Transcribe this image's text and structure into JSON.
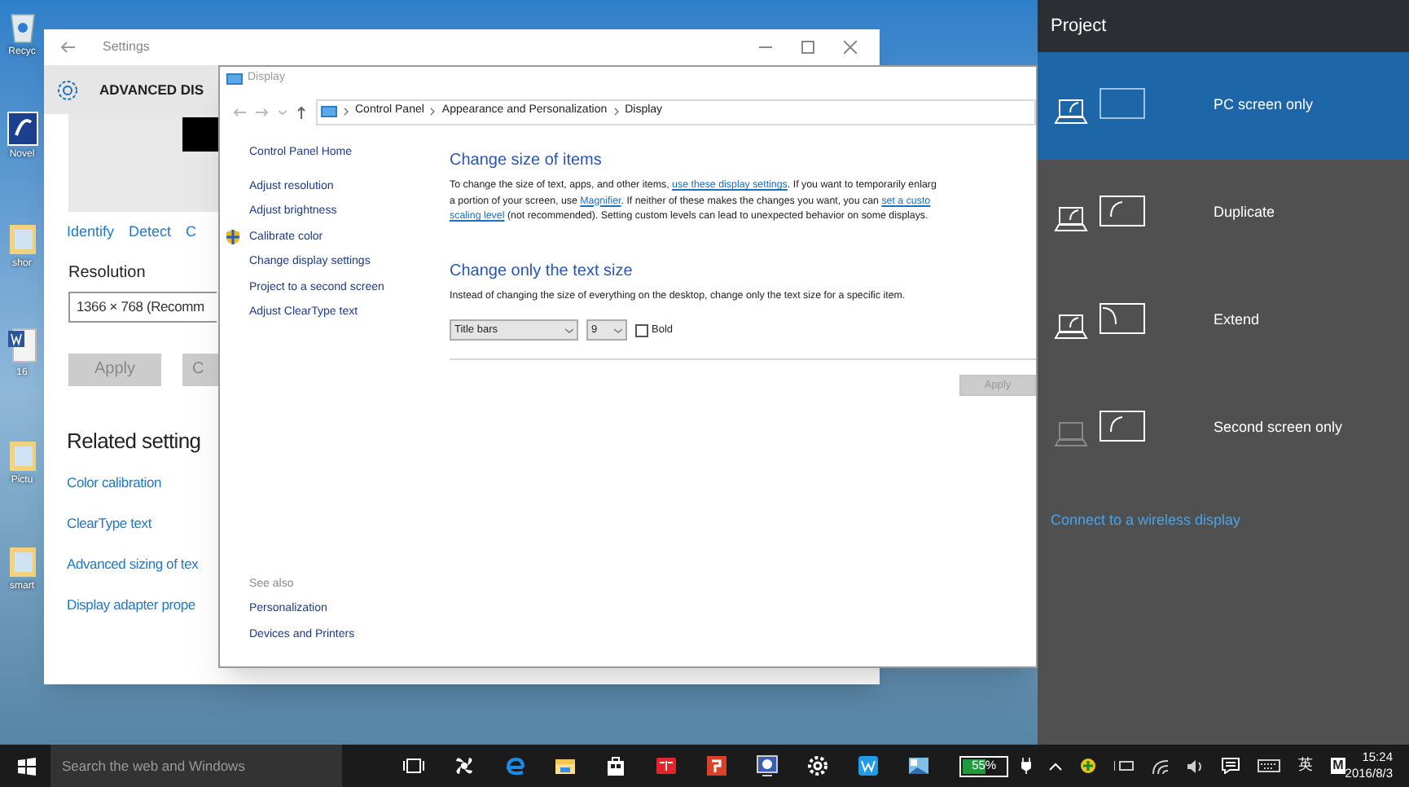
{
  "desktop_icons": [
    {
      "label": "Recyc",
      "kind": "bin"
    },
    {
      "label": "Novel",
      "kind": "app"
    },
    {
      "label": "shor",
      "kind": "folder"
    },
    {
      "label": "16",
      "kind": "doc"
    },
    {
      "label": "Pictu",
      "kind": "folder"
    },
    {
      "label": "smart",
      "kind": "folder"
    }
  ],
  "settings_window": {
    "title": "Settings",
    "header": "ADVANCED DIS",
    "links": [
      "Identify",
      "Detect",
      "C"
    ],
    "resolution_label": "Resolution",
    "resolution_value": "1366 × 768 (Recomm",
    "buttons": [
      "Apply",
      "C"
    ],
    "related_heading": "Related setting",
    "related_links": [
      "Color calibration",
      "ClearType text",
      "Advanced sizing of tex",
      "Display adapter prope"
    ]
  },
  "display_window": {
    "title": "Display",
    "breadcrumb": [
      "Control Panel",
      "Appearance and Personalization",
      "Display"
    ],
    "nav_home": "Control Panel Home",
    "nav_items": [
      {
        "label": "Adjust resolution",
        "kind": "link"
      },
      {
        "label": "Adjust brightness",
        "kind": "link"
      },
      {
        "label": "Calibrate color",
        "kind": "shield"
      },
      {
        "label": "Change display settings",
        "kind": "link"
      },
      {
        "label": "Project to a second screen",
        "kind": "link"
      },
      {
        "label": "Adjust ClearType text",
        "kind": "link"
      }
    ],
    "see_also_label": "See also",
    "see_also": [
      "Personalization",
      "Devices and Printers"
    ],
    "sections": [
      {
        "heading": "Change size of items",
        "lines": [
          [
            {
              "text": "To change the size of text, apps, and other items, ",
              "link": false
            },
            {
              "text": "use these display settings",
              "link": true
            },
            {
              "text": ".  If you want to temporarily enlarg",
              "link": false
            }
          ],
          [
            {
              "text": "a portion of your screen, use ",
              "link": false
            },
            {
              "text": "Magnifier",
              "link": true
            },
            {
              "text": ".  If neither of these makes the changes you want, you can ",
              "link": false
            },
            {
              "text": "set a custo",
              "link": true
            }
          ],
          [
            {
              "text": "scaling level",
              "link": true
            },
            {
              "text": " (not recommended).  Setting custom levels can lead to unexpected behavior on some displays.",
              "link": false
            }
          ]
        ]
      },
      {
        "heading": "Change only the text size",
        "lines": [
          [
            {
              "text": "Instead of changing the size of everything on the desktop, change only the text size for a specific item.",
              "link": false
            }
          ]
        ]
      }
    ],
    "item_select": "Title bars",
    "size_select": "9",
    "bold": {
      "label": "Bold",
      "checked": false
    },
    "apply": {
      "label": "Apply",
      "disabled": true
    }
  },
  "project_panel": {
    "title": "Project",
    "options": [
      {
        "label": "PC screen only",
        "kind": "pc",
        "selected": true
      },
      {
        "label": "Duplicate",
        "kind": "duplicate",
        "selected": false
      },
      {
        "label": "Extend",
        "kind": "extend",
        "selected": false
      },
      {
        "label": "Second screen only",
        "kind": "second",
        "selected": false
      }
    ],
    "link": "Connect to a wireless display"
  },
  "taskbar": {
    "search_placeholder": "Search the web and Windows",
    "apps": [
      {
        "kind": "taskview"
      },
      {
        "kind": "fan"
      },
      {
        "kind": "edge"
      },
      {
        "kind": "folder"
      },
      {
        "kind": "store"
      },
      {
        "kind": "book"
      },
      {
        "kind": "redapp"
      },
      {
        "kind": "monitor"
      },
      {
        "kind": "gear"
      },
      {
        "kind": "wapp"
      },
      {
        "kind": "picture"
      }
    ],
    "battery": {
      "label": "55%",
      "level": 0.55
    },
    "ime": "英",
    "ime_mode": "M",
    "time": "15:24",
    "date": "2016/8/3"
  }
}
